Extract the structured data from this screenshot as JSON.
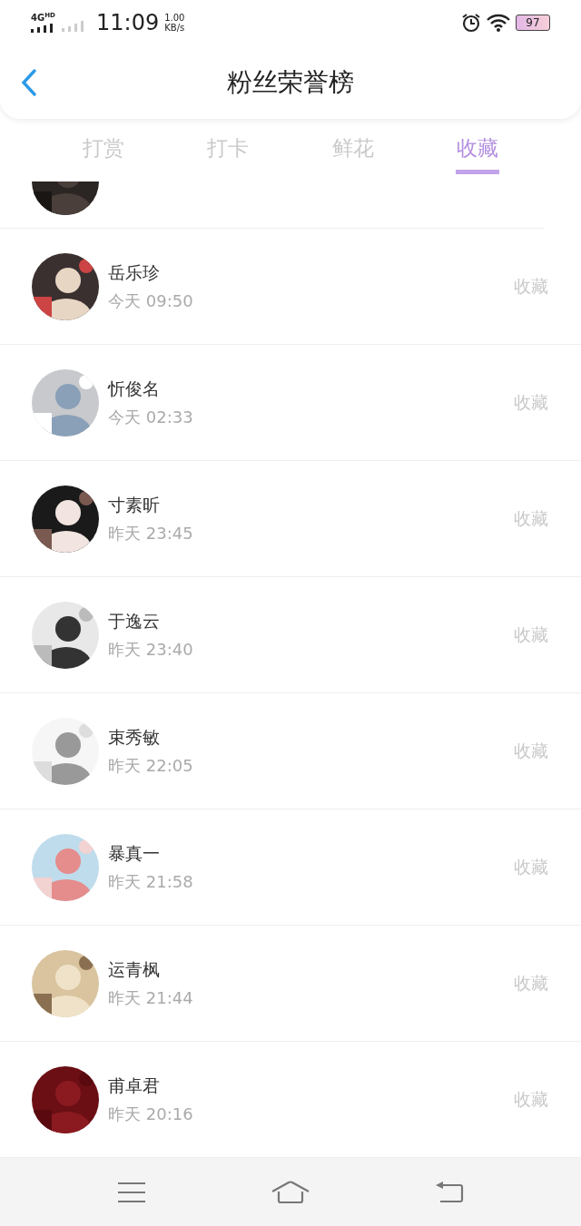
{
  "status_bar": {
    "network": "4G",
    "hd": "HD",
    "time": "11:09",
    "speed_value": "1.00",
    "speed_unit": "KB/s",
    "battery": "97"
  },
  "header": {
    "title": "粉丝荣誉榜"
  },
  "tabs": [
    {
      "label": "打赏",
      "selected": false
    },
    {
      "label": "打卡",
      "selected": false
    },
    {
      "label": "鲜花",
      "selected": false
    },
    {
      "label": "收藏",
      "selected": true
    }
  ],
  "fans": [
    {
      "name": "岳乐珍",
      "time": "今天 09:50",
      "action": "收藏"
    },
    {
      "name": "忻俊名",
      "time": "今天 02:33",
      "action": "收藏"
    },
    {
      "name": "寸素昕",
      "time": "昨天 23:45",
      "action": "收藏"
    },
    {
      "name": "于逸云",
      "time": "昨天 23:40",
      "action": "收藏"
    },
    {
      "name": "束秀敏",
      "time": "昨天 22:05",
      "action": "收藏"
    },
    {
      "name": "暴真一",
      "time": "昨天 21:58",
      "action": "收藏"
    },
    {
      "name": "运青枫",
      "time": "昨天 21:44",
      "action": "收藏"
    },
    {
      "name": "甫卓君",
      "time": "昨天 20:16",
      "action": "收藏"
    }
  ]
}
